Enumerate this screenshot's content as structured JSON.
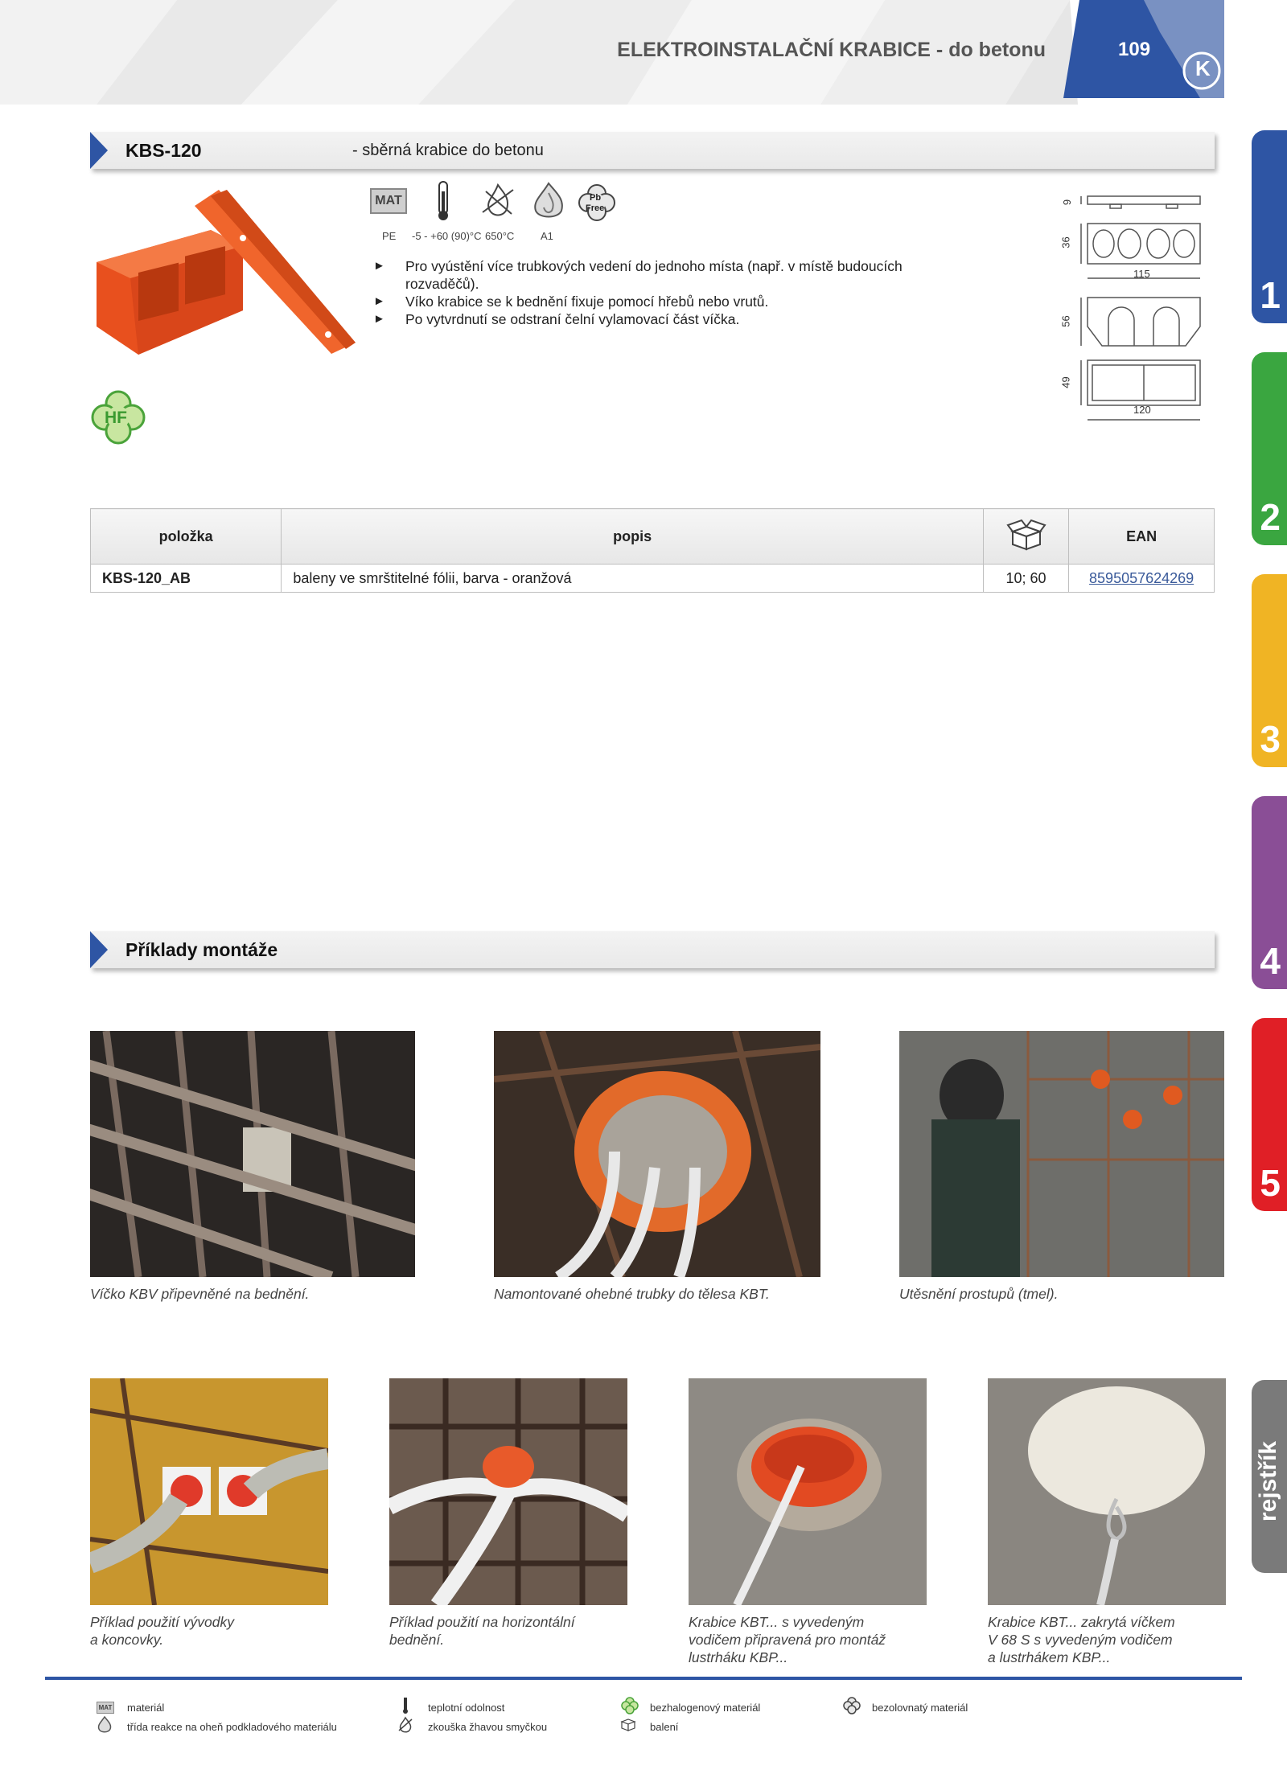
{
  "header": {
    "title": "ELEKTROINSTALAČNÍ KRABICE - do betonu",
    "page_number": "109",
    "logo": "K"
  },
  "chapter_tabs": [
    {
      "label": "1",
      "color": "#2e55a4"
    },
    {
      "label": "2",
      "color": "#3aa640"
    },
    {
      "label": "3",
      "color": "#f0b424"
    },
    {
      "label": "4",
      "color": "#8a4e96"
    },
    {
      "label": "5",
      "color": "#e01f26"
    },
    {
      "label": "rejstřík",
      "color": "#7a7a7a"
    }
  ],
  "product": {
    "code": "KBS-120",
    "description": "- sběrná krabice do betonu",
    "icons": [
      {
        "name": "material-icon",
        "glyph": "MAT",
        "caption": "PE"
      },
      {
        "name": "thermometer-icon",
        "caption": "-5 - +60 (90)°C"
      },
      {
        "name": "glow-wire-icon",
        "caption": "650°C"
      },
      {
        "name": "flame-reaction-icon",
        "caption": "A1"
      },
      {
        "name": "lead-free-icon",
        "glyph_1": "Pb",
        "glyph_2": "Free",
        "caption": ""
      }
    ],
    "hf_badge": "HF",
    "bullets": [
      "Pro vyústění více trubkových vedení do jednoho místa (např. v místě budoucích rozvaděčů).",
      "Víko krabice se k bednění fixuje pomocí hřebů nebo vrutů.",
      "Po vytvrdnutí se odstraní čelní vylamovací část víčka."
    ],
    "dimensions": {
      "d1": "9",
      "d2": "36",
      "w1": "115",
      "d3": "56",
      "d4": "49",
      "w2": "120"
    }
  },
  "table": {
    "headers": {
      "item": "položka",
      "desc": "popis",
      "pack_icon": "box-icon",
      "ean": "EAN"
    },
    "rows": [
      {
        "item": "KBS-120_AB",
        "desc": "baleny ve smrštitelné fólii, barva - oranžová",
        "pack": "10; 60",
        "ean": "8595057624269"
      }
    ]
  },
  "examples": {
    "title": "Příklady montáže",
    "captions_row1": [
      "Víčko KBV připevněné na bednění.",
      "Namontované ohebné trubky do tělesa KBT.",
      "Utěsnění prostupů (tmel)."
    ],
    "captions_row2": [
      [
        "Příklad použití vývodky",
        "a koncovky."
      ],
      [
        "Příklad použití na horizontální",
        "bednění."
      ],
      [
        "Krabice KBT... s vyvedeným",
        "vodičem připravená pro montáž",
        "lustrháku KBP..."
      ],
      [
        "Krabice KBT... zakrytá víčkem",
        "V 68 S s vyvedeným vodičem",
        "a lustrhákem KBP..."
      ]
    ]
  },
  "legend": [
    {
      "icon": "material-icon",
      "glyph": "MAT",
      "text": "materiál"
    },
    {
      "icon": "thermometer-icon",
      "text": "teplotní odolnost"
    },
    {
      "icon": "halogen-free-icon",
      "glyph": "HF",
      "text": "bezhalogenový materiál"
    },
    {
      "icon": "lead-free-icon",
      "text": "bezolovnatý materiál"
    },
    {
      "icon": "flame-reaction-icon",
      "text": "třída reakce na oheň podkladového materiálu"
    },
    {
      "icon": "glow-wire-icon",
      "text": "zkouška žhavou smyčkou"
    },
    {
      "icon": "box-icon",
      "text": "balení"
    }
  ]
}
